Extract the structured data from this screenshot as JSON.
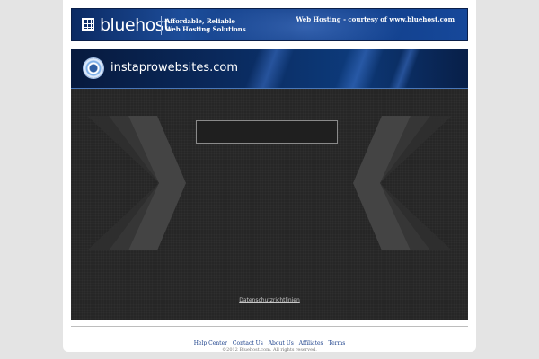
{
  "header": {
    "logo_text": "bluehost",
    "tagline_line1": "Affordable, Reliable",
    "tagline_line2": "Web Hosting Solutions",
    "courtesy_text": "Web Hosting - courtesy of www.bluehost.com"
  },
  "domain_bar": {
    "domain_name": "instaprowebsites.com",
    "icon": "domain-ring-icon"
  },
  "content": {
    "search_value": "",
    "search_placeholder": "",
    "privacy_link": "Datenschutzrichtlinien"
  },
  "footer": {
    "links": [
      "Help Center",
      "Contact Us",
      "About Us",
      "Affiliates",
      "Terms"
    ],
    "copyright": "©2012 Bluehost.com. All rights reserved."
  },
  "colors": {
    "header_blue": "#1d4d9a",
    "content_bg": "#262626",
    "link_blue": "#1a3f8a"
  }
}
